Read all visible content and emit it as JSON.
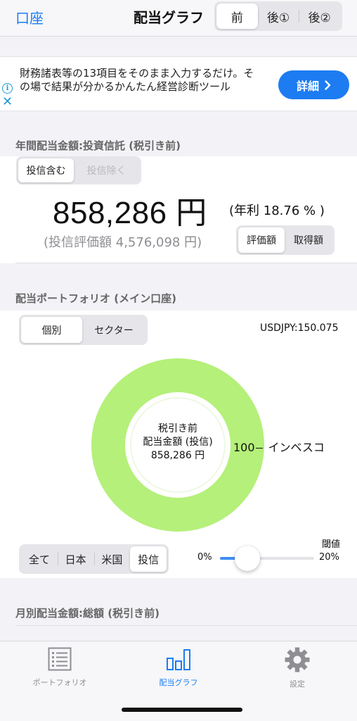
{
  "nav": {
    "back_label": "口座",
    "title": "配当グラフ",
    "segments": [
      "前",
      "後①",
      "後②"
    ]
  },
  "ad": {
    "text": "財務諸表等の13項目をそのまま入力するだけ。その場で結果が分かるかんたん経営診断ツール",
    "button": "詳細",
    "info_glyph": "i",
    "close_glyph": "✕"
  },
  "annual": {
    "header": "年間配当金額:投資信託 (税引き前)",
    "toggle": [
      "投信含む",
      "投信除く"
    ],
    "amount": "858,286 円",
    "yield": "(年利 18.76 % )",
    "valuation": "(投信評価額 4,576,098 円)",
    "basis": [
      "評価額",
      "取得額"
    ]
  },
  "portfolio": {
    "header": "配当ポートフォリオ (メイン口座)",
    "view_tabs": [
      "個別",
      "セクター"
    ],
    "fx_rate": "USDJPY:150.075",
    "center_line1": "税引き前",
    "center_line2": "配当金額 (投信)",
    "center_line3": "858,286 円",
    "filters": [
      "全て",
      "日本",
      "米国",
      "投信"
    ],
    "threshold_label": "閾値",
    "slider_min": "0%",
    "slider_max": "20%"
  },
  "chart_data": {
    "type": "pie",
    "categories": [
      "インベスコ"
    ],
    "values": [
      100
    ],
    "slice_label": "100",
    "colors": [
      "#b5f07a"
    ]
  },
  "slider": {
    "value_percent": 2,
    "fill_color": "#3d8ef5"
  },
  "monthly": {
    "header": "月別配当金額:総額 (税引き前)"
  },
  "tabbar": {
    "items": [
      {
        "label": "ポートフォリオ",
        "icon": "list-icon"
      },
      {
        "label": "配当グラフ",
        "icon": "bar-chart-icon"
      },
      {
        "label": "設定",
        "icon": "gear-icon"
      }
    ]
  },
  "colors": {
    "accent": "#1d7cf2",
    "donut": "#b5f07a"
  }
}
